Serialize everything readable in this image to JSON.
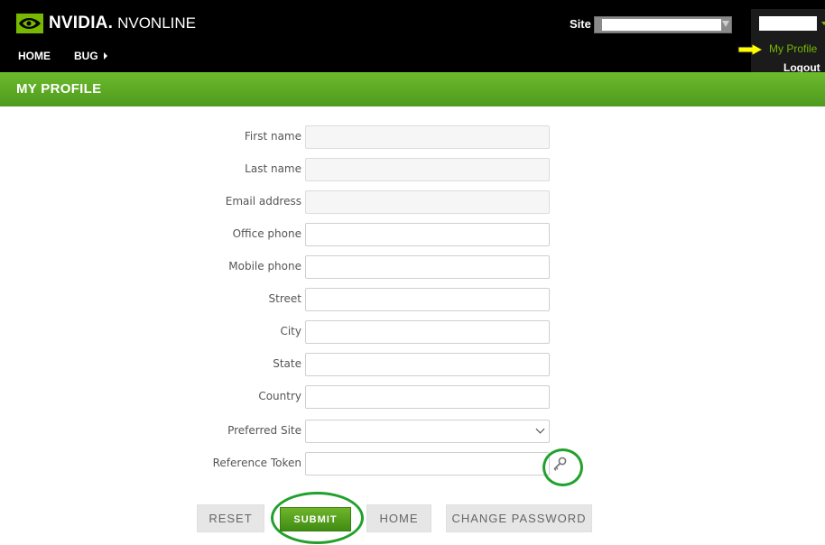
{
  "header": {
    "brand": "NVIDIA.",
    "product": "NVONLINE",
    "site_label": "Site",
    "site_value": ""
  },
  "nav": [
    {
      "label": "HOME",
      "has_submenu": false
    },
    {
      "label": "BUG",
      "has_submenu": true
    }
  ],
  "user_menu": {
    "username": "",
    "items": [
      "My Profile",
      "Logout"
    ]
  },
  "page": {
    "title": "MY PROFILE"
  },
  "form": {
    "fields": [
      {
        "label": "First name",
        "value": "",
        "readonly": true
      },
      {
        "label": "Last name",
        "value": "",
        "readonly": true
      },
      {
        "label": "Email address",
        "value": "",
        "readonly": true
      },
      {
        "label": "Office phone",
        "value": ""
      },
      {
        "label": "Mobile phone",
        "value": ""
      },
      {
        "label": "Street",
        "value": ""
      },
      {
        "label": "City",
        "value": ""
      },
      {
        "label": "State",
        "value": ""
      },
      {
        "label": "Country",
        "value": ""
      },
      {
        "label": "Preferred Site",
        "value": "",
        "type": "select"
      },
      {
        "label": "Reference Token",
        "value": ""
      }
    ]
  },
  "buttons": {
    "reset": "RESET",
    "submit": "SUBMIT",
    "home": "HOME",
    "change_password": "CHANGE PASSWORD"
  },
  "colors": {
    "accent": "#76b900",
    "header_green": "#5fae26",
    "highlight_ring": "#21a12c",
    "pointer_arrow": "#ffff00"
  },
  "icons": {
    "token": "key-icon",
    "pointer": "arrow-right-icon"
  }
}
